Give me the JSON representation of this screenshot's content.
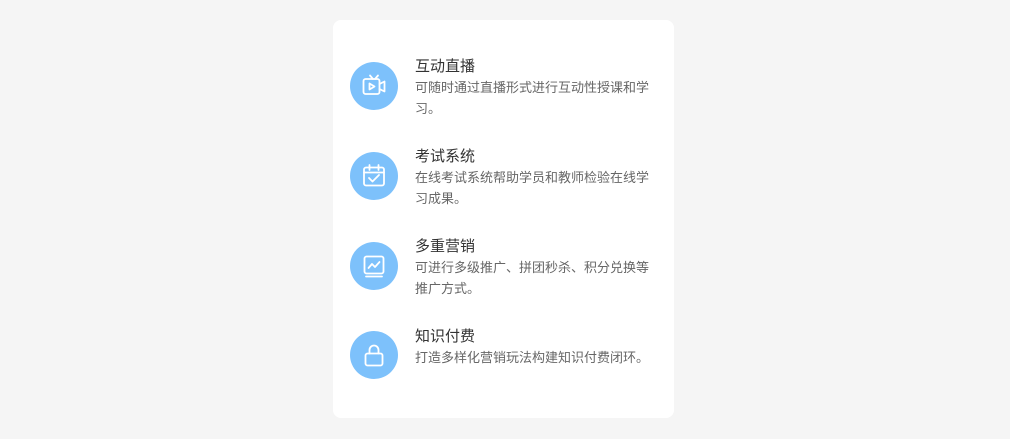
{
  "features": [
    {
      "title": "互动直播",
      "description": "可随时通过直播形式进行互动性授课和学习。",
      "icon": "live-tv-icon"
    },
    {
      "title": "考试系统",
      "description": "在线考试系统帮助学员和教师检验在线学习成果。",
      "icon": "calendar-check-icon"
    },
    {
      "title": "多重营销",
      "description": "可进行多级推广、拼团秒杀、积分兑换等推广方式。",
      "icon": "chart-monitor-icon"
    },
    {
      "title": "知识付费",
      "description": "打造多样化营销玩法构建知识付费闭环。",
      "icon": "lock-icon"
    }
  ],
  "colors": {
    "page_background": "#f5f5f5",
    "card_background": "#ffffff",
    "icon_background": "#7dc1fb",
    "title_text": "#333333",
    "description_text": "#666666"
  }
}
